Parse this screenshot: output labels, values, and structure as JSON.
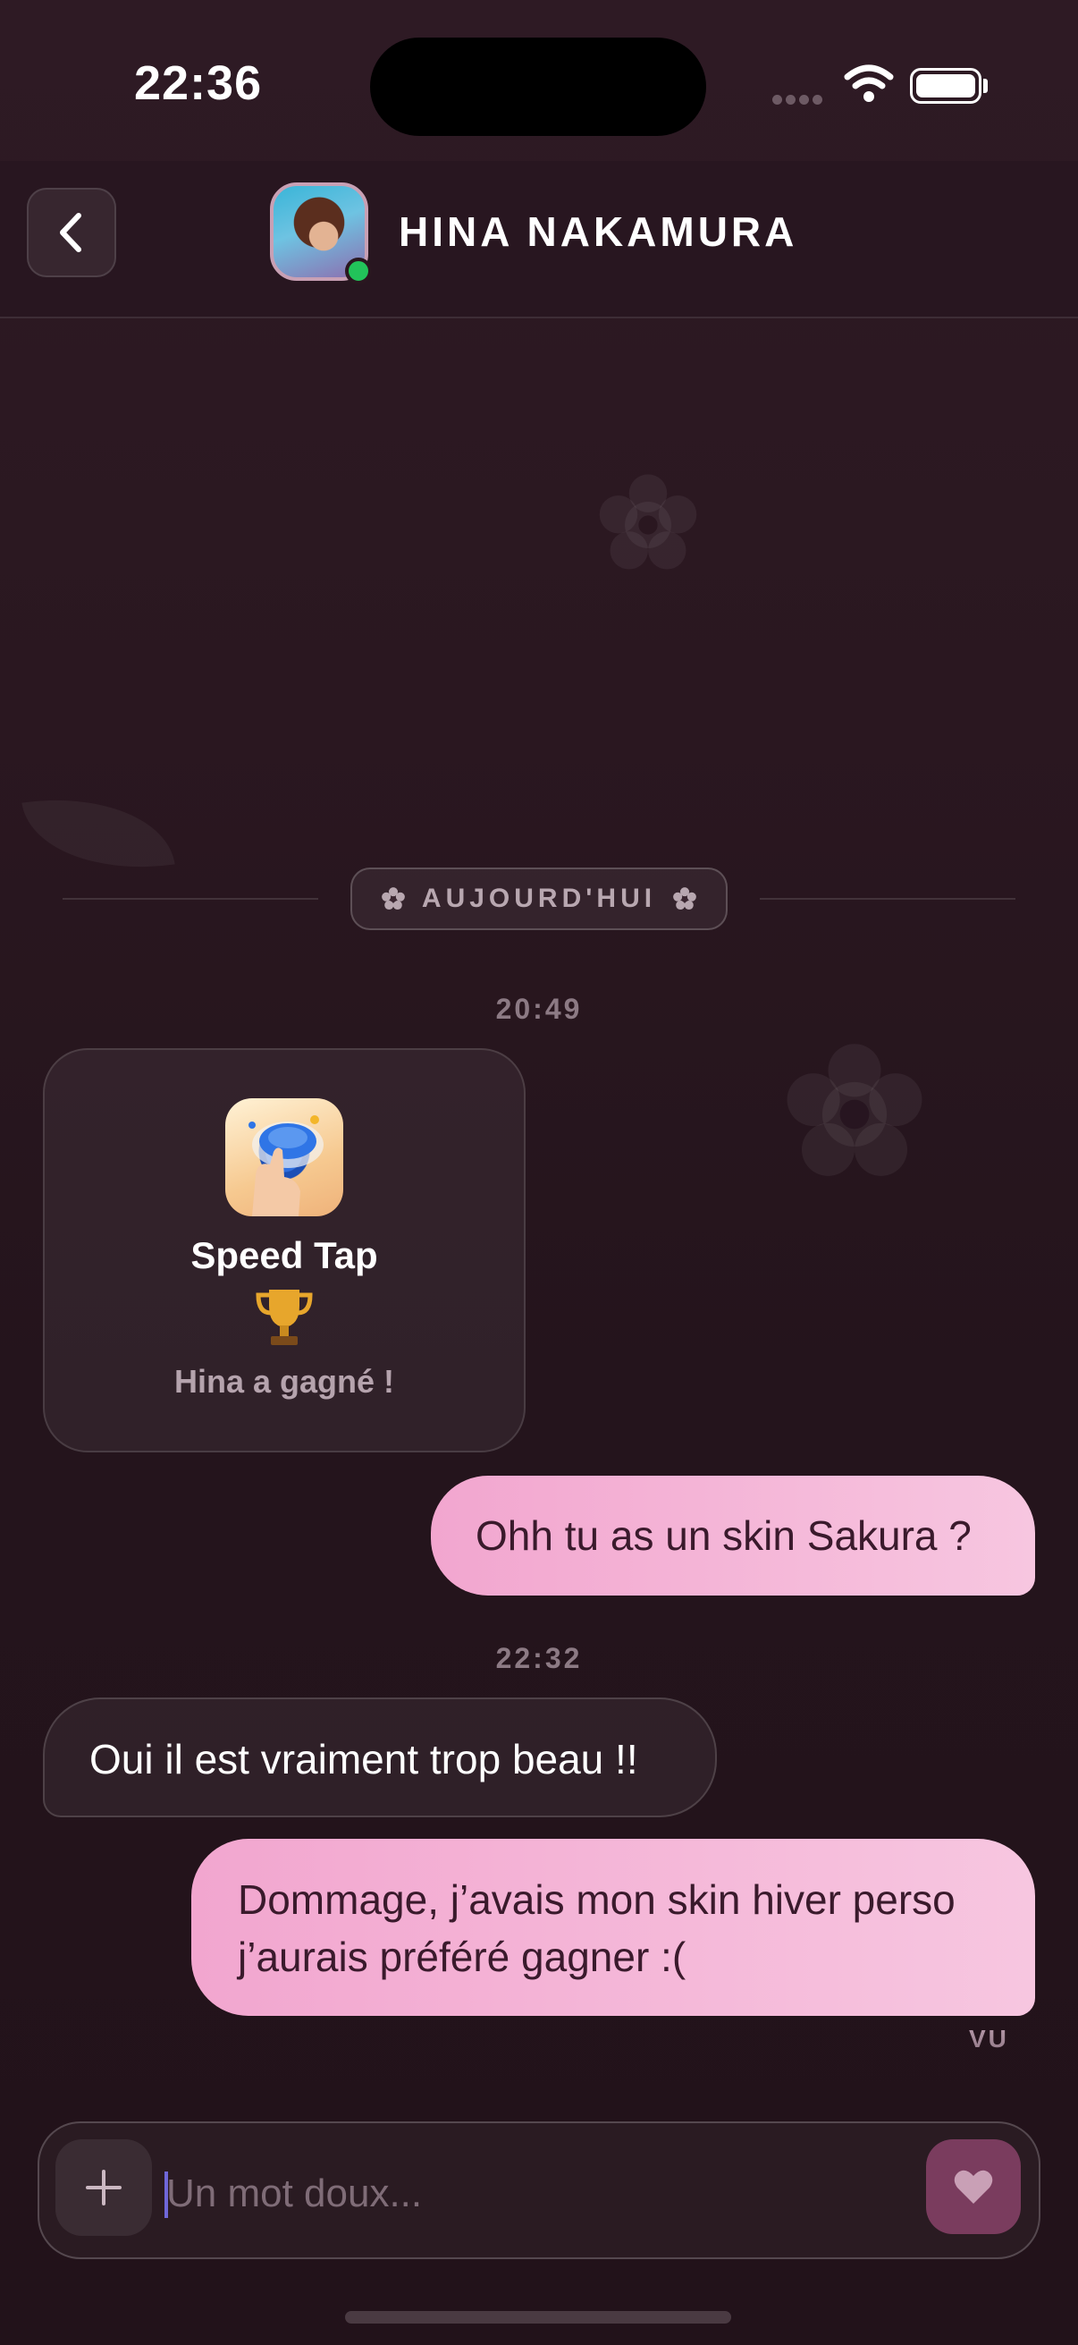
{
  "status_bar": {
    "time": "22:36"
  },
  "header": {
    "contact_name": "HINA NAKAMURA"
  },
  "date_separator": {
    "label": "AUJOURD'HUI"
  },
  "timestamps": [
    "20:49",
    "22:32"
  ],
  "game_card": {
    "title": "Speed Tap",
    "result": "Hina a gagné !"
  },
  "messages": [
    {
      "from": "me",
      "text": "Ohh tu as un skin Sakura ?"
    },
    {
      "from": "contact",
      "text": "Oui il est vraiment trop beau !!"
    },
    {
      "from": "me",
      "text": "Dommage, j’avais mon skin hiver perso j’aurais préféré gagner :("
    }
  ],
  "read_receipt": "VU",
  "composer": {
    "placeholder": "Un mot doux..."
  },
  "colors": {
    "outgoing_bubble": "#f4b3d6",
    "online": "#22c35a",
    "heart_button": "#7a3c5e"
  }
}
